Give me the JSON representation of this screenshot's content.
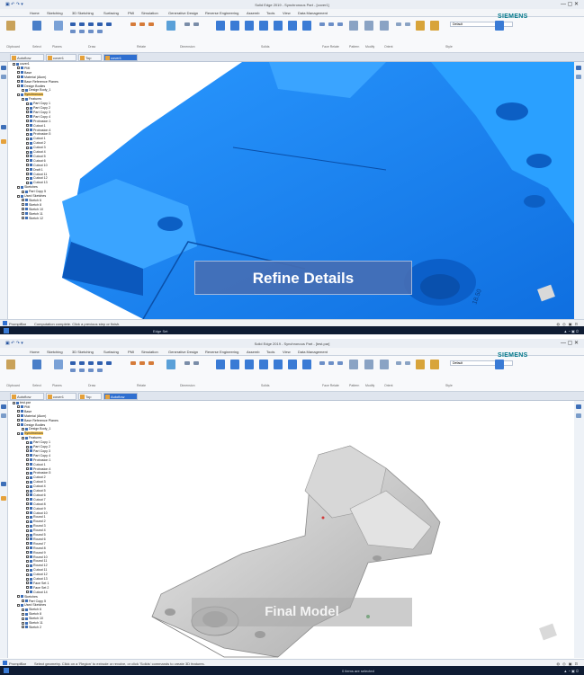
{
  "app": {
    "menus": [
      "Home",
      "Sketching",
      "3D Sketching",
      "Surfacing",
      "PMI",
      "Simulation",
      "Generative Design",
      "Reverse Engineering",
      "Assemb",
      "Tools",
      "View",
      "Data Management"
    ],
    "brand": "SIEMENS",
    "ribbon_groups": [
      "Clipboard",
      "Select",
      "Planes",
      "Draw",
      "Relate",
      "Dimension",
      "Solids",
      "Face Relate",
      "Pattern",
      "Modify",
      "Orient",
      "Style"
    ],
    "style_value": "Default",
    "search_placeholder": ""
  },
  "panes": [
    {
      "window_title": "Solid Edge 2019 - Synchronous Part - [cover1]",
      "tabs": [
        "Autoflow",
        "cover1",
        "Top",
        "cover1"
      ],
      "active_tab_index": 3,
      "tree": [
        {
          "label": "cover1",
          "indent": 0,
          "icon": "part"
        },
        {
          "label": "PMI",
          "indent": 1,
          "icon": "pmi"
        },
        {
          "label": "Base",
          "indent": 1,
          "icon": "base"
        },
        {
          "label": "Material (Alum)",
          "indent": 1,
          "icon": "material"
        },
        {
          "label": "Base Reference Planes",
          "indent": 1,
          "icon": "planes"
        },
        {
          "label": "Design Bodies",
          "indent": 1,
          "icon": "bodies"
        },
        {
          "label": "Design Body_1",
          "indent": 2,
          "icon": "body"
        },
        {
          "label": "Synchronous",
          "indent": 1,
          "icon": "sync",
          "highlight": true
        },
        {
          "label": "Features",
          "indent": 2,
          "icon": "features"
        },
        {
          "label": "Part Copy 1",
          "indent": 3,
          "icon": "copy"
        },
        {
          "label": "Part Copy 2",
          "indent": 3,
          "icon": "copy"
        },
        {
          "label": "Part Copy 3",
          "indent": 3,
          "icon": "copy"
        },
        {
          "label": "Part Copy 4",
          "indent": 3,
          "icon": "copy"
        },
        {
          "label": "Protrusion 1",
          "indent": 3,
          "icon": "feature"
        },
        {
          "label": "Cutout 1",
          "indent": 3,
          "icon": "feature"
        },
        {
          "label": "Protrusion 4",
          "indent": 3,
          "icon": "feature"
        },
        {
          "label": "Protrusion 5",
          "indent": 3,
          "icon": "feature"
        },
        {
          "label": "Cutout 1",
          "indent": 3,
          "icon": "feature"
        },
        {
          "label": "Cutout 2",
          "indent": 3,
          "icon": "feature"
        },
        {
          "label": "Cutout 3",
          "indent": 3,
          "icon": "feature"
        },
        {
          "label": "Cutout 4",
          "indent": 3,
          "icon": "feature"
        },
        {
          "label": "Cutout 5",
          "indent": 3,
          "icon": "feature"
        },
        {
          "label": "Cutout 6",
          "indent": 3,
          "icon": "feature"
        },
        {
          "label": "Cutout 10",
          "indent": 3,
          "icon": "feature"
        },
        {
          "label": "Draft 1",
          "indent": 3,
          "icon": "feature"
        },
        {
          "label": "Cutout 11",
          "indent": 3,
          "icon": "feature"
        },
        {
          "label": "Cutout 12",
          "indent": 3,
          "icon": "feature"
        },
        {
          "label": "Cutout 13",
          "indent": 3,
          "icon": "feature"
        },
        {
          "label": "Sketches",
          "indent": 1,
          "icon": "sketches"
        },
        {
          "label": "Part Copy 5",
          "indent": 2,
          "icon": "copy"
        },
        {
          "label": "Used Sketches",
          "indent": 1,
          "icon": "sketches"
        },
        {
          "label": "Sketch 6",
          "indent": 2,
          "icon": "sketch"
        },
        {
          "label": "Sketch 8",
          "indent": 2,
          "icon": "sketch"
        },
        {
          "label": "Sketch 10",
          "indent": 2,
          "icon": "sketch"
        },
        {
          "label": "Sketch 11",
          "indent": 2,
          "icon": "sketch"
        },
        {
          "label": "Sketch 12",
          "indent": 2,
          "icon": "sketch"
        }
      ],
      "status_text": "Computation complete. Click a previous step or finish.",
      "status_prompt": "PromptBar",
      "caption": "Refine Details",
      "dimension_label": "18.50",
      "taskbar_text": "Edge Set"
    },
    {
      "window_title": "Solid Edge 2019 - Synchronous Part - [test.par]",
      "tabs": [
        "Autoflow",
        "cover1",
        "Top",
        "Autoflow"
      ],
      "active_tab_index": 3,
      "tree": [
        {
          "label": "test.par",
          "indent": 0,
          "icon": "part"
        },
        {
          "label": "PMI",
          "indent": 1,
          "icon": "pmi"
        },
        {
          "label": "Base",
          "indent": 1,
          "icon": "base"
        },
        {
          "label": "Material (Alum)",
          "indent": 1,
          "icon": "material"
        },
        {
          "label": "Base Reference Planes",
          "indent": 1,
          "icon": "planes"
        },
        {
          "label": "Design Bodies",
          "indent": 1,
          "icon": "bodies"
        },
        {
          "label": "Design Body_1",
          "indent": 2,
          "icon": "body"
        },
        {
          "label": "Synchronous",
          "indent": 1,
          "icon": "sync",
          "highlight": true
        },
        {
          "label": "Features",
          "indent": 2,
          "icon": "features"
        },
        {
          "label": "Part Copy 1",
          "indent": 3,
          "icon": "copy"
        },
        {
          "label": "Part Copy 2",
          "indent": 3,
          "icon": "copy"
        },
        {
          "label": "Part Copy 3",
          "indent": 3,
          "icon": "copy"
        },
        {
          "label": "Part Copy 4",
          "indent": 3,
          "icon": "copy"
        },
        {
          "label": "Protrusion 1",
          "indent": 3,
          "icon": "feature"
        },
        {
          "label": "Cutout 1",
          "indent": 3,
          "icon": "feature"
        },
        {
          "label": "Protrusion 4",
          "indent": 3,
          "icon": "feature"
        },
        {
          "label": "Protrusion 5",
          "indent": 3,
          "icon": "feature"
        },
        {
          "label": "Cutout 2",
          "indent": 3,
          "icon": "feature"
        },
        {
          "label": "Cutout 3",
          "indent": 3,
          "icon": "feature"
        },
        {
          "label": "Cutout 4",
          "indent": 3,
          "icon": "feature"
        },
        {
          "label": "Cutout 5",
          "indent": 3,
          "icon": "feature"
        },
        {
          "label": "Cutout 6",
          "indent": 3,
          "icon": "feature"
        },
        {
          "label": "Cutout 7",
          "indent": 3,
          "icon": "feature"
        },
        {
          "label": "Cutout 8",
          "indent": 3,
          "icon": "feature"
        },
        {
          "label": "Cutout 9",
          "indent": 3,
          "icon": "feature"
        },
        {
          "label": "Cutout 10",
          "indent": 3,
          "icon": "feature"
        },
        {
          "label": "Round 1",
          "indent": 3,
          "icon": "feature"
        },
        {
          "label": "Round 2",
          "indent": 3,
          "icon": "feature"
        },
        {
          "label": "Round 3",
          "indent": 3,
          "icon": "feature"
        },
        {
          "label": "Round 4",
          "indent": 3,
          "icon": "feature"
        },
        {
          "label": "Round 5",
          "indent": 3,
          "icon": "feature"
        },
        {
          "label": "Round 6",
          "indent": 3,
          "icon": "feature"
        },
        {
          "label": "Round 7",
          "indent": 3,
          "icon": "feature"
        },
        {
          "label": "Round 8",
          "indent": 3,
          "icon": "feature"
        },
        {
          "label": "Round 9",
          "indent": 3,
          "icon": "feature"
        },
        {
          "label": "Round 10",
          "indent": 3,
          "icon": "feature"
        },
        {
          "label": "Round 11",
          "indent": 3,
          "icon": "feature"
        },
        {
          "label": "Round 12",
          "indent": 3,
          "icon": "feature"
        },
        {
          "label": "Cutout 11",
          "indent": 3,
          "icon": "feature"
        },
        {
          "label": "Cutout 12",
          "indent": 3,
          "icon": "feature"
        },
        {
          "label": "Cutout 13",
          "indent": 3,
          "icon": "feature"
        },
        {
          "label": "Face Set 1",
          "indent": 3,
          "icon": "feature"
        },
        {
          "label": "Face Set 2",
          "indent": 3,
          "icon": "feature"
        },
        {
          "label": "Cutout 14",
          "indent": 3,
          "icon": "feature"
        },
        {
          "label": "Sketches",
          "indent": 1,
          "icon": "sketches"
        },
        {
          "label": "Part Copy 5",
          "indent": 2,
          "icon": "copy"
        },
        {
          "label": "Used Sketches",
          "indent": 1,
          "icon": "sketches"
        },
        {
          "label": "Sketch 6",
          "indent": 2,
          "icon": "sketch"
        },
        {
          "label": "Sketch 8",
          "indent": 2,
          "icon": "sketch"
        },
        {
          "label": "Sketch 10",
          "indent": 2,
          "icon": "sketch"
        },
        {
          "label": "Sketch 11",
          "indent": 2,
          "icon": "sketch"
        },
        {
          "label": "Sketch 2",
          "indent": 2,
          "icon": "sketch"
        }
      ],
      "status_text": "Select geometry. Click on a 'Region' to extrude or revolve, or click 'Solids' commands to create 3D features.",
      "status_prompt": "PromptBar",
      "caption": "Final Model",
      "taskbar_text": "0 items are selected"
    }
  ],
  "colors": {
    "part_blue": "#1f8cf5",
    "part_blue_dark": "#0c5fc4",
    "part_gray": "#cfcfcf",
    "accent": "#2f6fd0",
    "caption_bg": "#4a6fb0",
    "brand_teal": "#00778a",
    "highlight": "#ffd26a"
  }
}
